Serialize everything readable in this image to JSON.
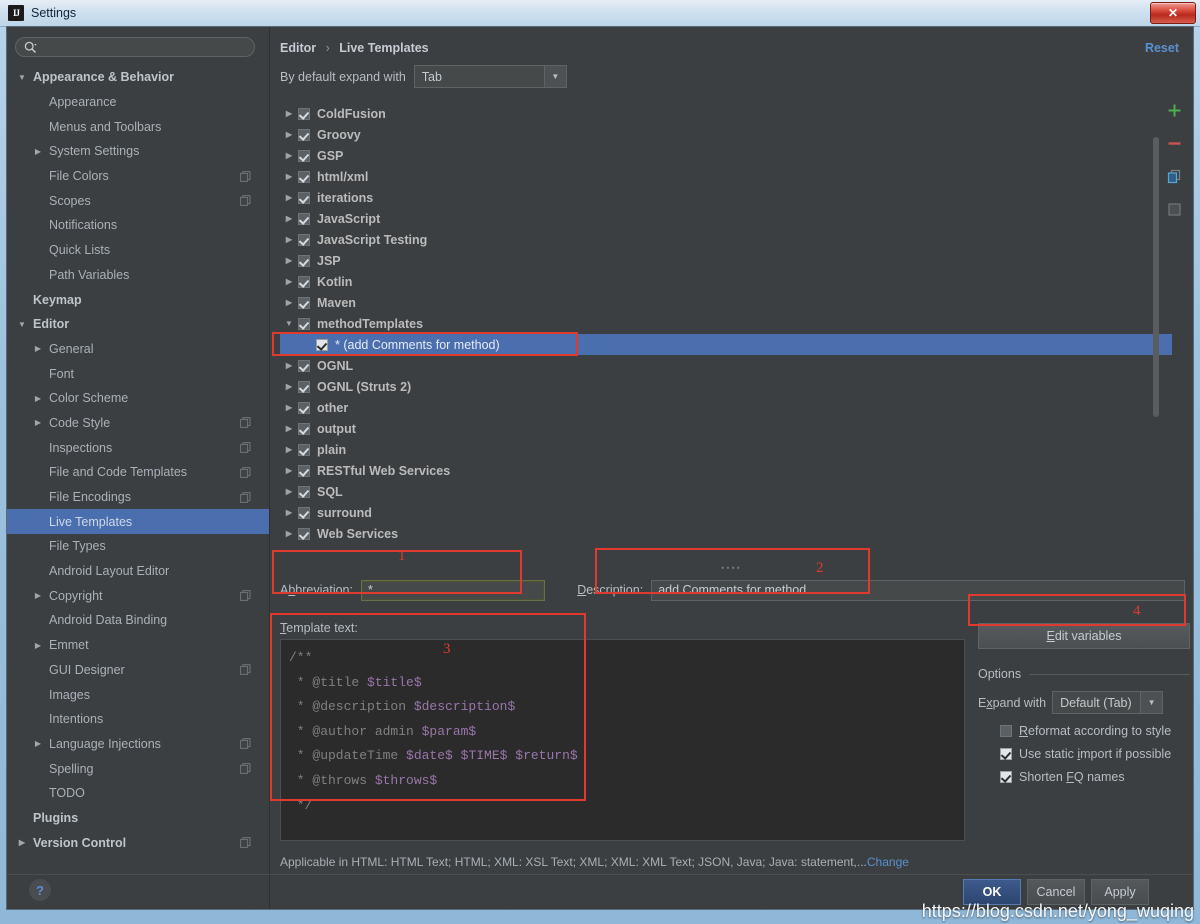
{
  "window": {
    "title": "Settings",
    "app_icon": "IJ",
    "close_label": "✕"
  },
  "search": {
    "placeholder": "",
    "value": "",
    "icon": "search-icon"
  },
  "sidebar": {
    "items": [
      {
        "label": "Appearance & Behavior",
        "arrow": "▼",
        "indent": 0,
        "bold": true,
        "badge": false,
        "selected": false
      },
      {
        "label": "Appearance",
        "arrow": "",
        "indent": 1,
        "bold": false,
        "badge": false,
        "selected": false
      },
      {
        "label": "Menus and Toolbars",
        "arrow": "",
        "indent": 1,
        "bold": false,
        "badge": false,
        "selected": false
      },
      {
        "label": "System Settings",
        "arrow": "▶",
        "indent": 1,
        "bold": false,
        "badge": false,
        "selected": false
      },
      {
        "label": "File Colors",
        "arrow": "",
        "indent": 1,
        "bold": false,
        "badge": true,
        "selected": false
      },
      {
        "label": "Scopes",
        "arrow": "",
        "indent": 1,
        "bold": false,
        "badge": true,
        "selected": false
      },
      {
        "label": "Notifications",
        "arrow": "",
        "indent": 1,
        "bold": false,
        "badge": false,
        "selected": false
      },
      {
        "label": "Quick Lists",
        "arrow": "",
        "indent": 1,
        "bold": false,
        "badge": false,
        "selected": false
      },
      {
        "label": "Path Variables",
        "arrow": "",
        "indent": 1,
        "bold": false,
        "badge": false,
        "selected": false
      },
      {
        "label": "Keymap",
        "arrow": "",
        "indent": 0,
        "bold": true,
        "badge": false,
        "selected": false
      },
      {
        "label": "Editor",
        "arrow": "▼",
        "indent": 0,
        "bold": true,
        "badge": false,
        "selected": false
      },
      {
        "label": "General",
        "arrow": "▶",
        "indent": 1,
        "bold": false,
        "badge": false,
        "selected": false
      },
      {
        "label": "Font",
        "arrow": "",
        "indent": 1,
        "bold": false,
        "badge": false,
        "selected": false
      },
      {
        "label": "Color Scheme",
        "arrow": "▶",
        "indent": 1,
        "bold": false,
        "badge": false,
        "selected": false
      },
      {
        "label": "Code Style",
        "arrow": "▶",
        "indent": 1,
        "bold": false,
        "badge": true,
        "selected": false
      },
      {
        "label": "Inspections",
        "arrow": "",
        "indent": 1,
        "bold": false,
        "badge": true,
        "selected": false
      },
      {
        "label": "File and Code Templates",
        "arrow": "",
        "indent": 1,
        "bold": false,
        "badge": true,
        "selected": false
      },
      {
        "label": "File Encodings",
        "arrow": "",
        "indent": 1,
        "bold": false,
        "badge": true,
        "selected": false
      },
      {
        "label": "Live Templates",
        "arrow": "",
        "indent": 1,
        "bold": false,
        "badge": false,
        "selected": true
      },
      {
        "label": "File Types",
        "arrow": "",
        "indent": 1,
        "bold": false,
        "badge": false,
        "selected": false
      },
      {
        "label": "Android Layout Editor",
        "arrow": "",
        "indent": 1,
        "bold": false,
        "badge": false,
        "selected": false
      },
      {
        "label": "Copyright",
        "arrow": "▶",
        "indent": 1,
        "bold": false,
        "badge": true,
        "selected": false
      },
      {
        "label": "Android Data Binding",
        "arrow": "",
        "indent": 1,
        "bold": false,
        "badge": false,
        "selected": false
      },
      {
        "label": "Emmet",
        "arrow": "▶",
        "indent": 1,
        "bold": false,
        "badge": false,
        "selected": false
      },
      {
        "label": "GUI Designer",
        "arrow": "",
        "indent": 1,
        "bold": false,
        "badge": true,
        "selected": false
      },
      {
        "label": "Images",
        "arrow": "",
        "indent": 1,
        "bold": false,
        "badge": false,
        "selected": false
      },
      {
        "label": "Intentions",
        "arrow": "",
        "indent": 1,
        "bold": false,
        "badge": false,
        "selected": false
      },
      {
        "label": "Language Injections",
        "arrow": "▶",
        "indent": 1,
        "bold": false,
        "badge": true,
        "selected": false
      },
      {
        "label": "Spelling",
        "arrow": "",
        "indent": 1,
        "bold": false,
        "badge": true,
        "selected": false
      },
      {
        "label": "TODO",
        "arrow": "",
        "indent": 1,
        "bold": false,
        "badge": false,
        "selected": false
      },
      {
        "label": "Plugins",
        "arrow": "",
        "indent": 0,
        "bold": true,
        "badge": false,
        "selected": false
      },
      {
        "label": "Version Control",
        "arrow": "▶",
        "indent": 0,
        "bold": true,
        "badge": true,
        "selected": false
      }
    ]
  },
  "main": {
    "breadcrumb_parent": "Editor",
    "breadcrumb_sep": "›",
    "breadcrumb_current": "Live Templates",
    "reset_label": "Reset",
    "expand_with_label": "By default expand with",
    "expand_with_value": "Tab",
    "combo_arrow": "▼"
  },
  "template_tree": {
    "rows": [
      {
        "label": "ColdFusion",
        "arrow": "▶",
        "child": false,
        "checked": true,
        "selected": false
      },
      {
        "label": "Groovy",
        "arrow": "▶",
        "child": false,
        "checked": true,
        "selected": false
      },
      {
        "label": "GSP",
        "arrow": "▶",
        "child": false,
        "checked": true,
        "selected": false
      },
      {
        "label": "html/xml",
        "arrow": "▶",
        "child": false,
        "checked": true,
        "selected": false
      },
      {
        "label": "iterations",
        "arrow": "▶",
        "child": false,
        "checked": true,
        "selected": false
      },
      {
        "label": "JavaScript",
        "arrow": "▶",
        "child": false,
        "checked": true,
        "selected": false
      },
      {
        "label": "JavaScript Testing",
        "arrow": "▶",
        "child": false,
        "checked": true,
        "selected": false
      },
      {
        "label": "JSP",
        "arrow": "▶",
        "child": false,
        "checked": true,
        "selected": false
      },
      {
        "label": "Kotlin",
        "arrow": "▶",
        "child": false,
        "checked": true,
        "selected": false
      },
      {
        "label": "Maven",
        "arrow": "▶",
        "child": false,
        "checked": true,
        "selected": false
      },
      {
        "label": "methodTemplates",
        "arrow": "▼",
        "child": false,
        "checked": true,
        "selected": false
      },
      {
        "label": "* (add Comments for method)",
        "arrow": "",
        "child": true,
        "checked": true,
        "selected": true
      },
      {
        "label": "OGNL",
        "arrow": "▶",
        "child": false,
        "checked": true,
        "selected": false
      },
      {
        "label": "OGNL (Struts 2)",
        "arrow": "▶",
        "child": false,
        "checked": true,
        "selected": false
      },
      {
        "label": "other",
        "arrow": "▶",
        "child": false,
        "checked": true,
        "selected": false
      },
      {
        "label": "output",
        "arrow": "▶",
        "child": false,
        "checked": true,
        "selected": false
      },
      {
        "label": "plain",
        "arrow": "▶",
        "child": false,
        "checked": true,
        "selected": false
      },
      {
        "label": "RESTful Web Services",
        "arrow": "▶",
        "child": false,
        "checked": true,
        "selected": false
      },
      {
        "label": "SQL",
        "arrow": "▶",
        "child": false,
        "checked": true,
        "selected": false
      },
      {
        "label": "surround",
        "arrow": "▶",
        "child": false,
        "checked": true,
        "selected": false
      },
      {
        "label": "Web Services",
        "arrow": "▶",
        "child": false,
        "checked": true,
        "selected": false
      }
    ],
    "toolbar": [
      {
        "name": "add-icon",
        "glyph": "+",
        "color": "#4caf50"
      },
      {
        "name": "remove-icon",
        "glyph": "–",
        "color": "#c75450"
      },
      {
        "name": "copy-icon",
        "glyph": "⧉",
        "color": "#4b93c9"
      },
      {
        "name": "paste-icon",
        "glyph": "▢",
        "color": "#6d7377"
      }
    ]
  },
  "details": {
    "abbreviation_label": "Abbreviation:",
    "abbreviation_value": "*",
    "description_label": "Description:",
    "description_value": "add Comments for method",
    "template_text_label": "Template text:",
    "template_lines": [
      "/**",
      " * @title $title$",
      " * @description $description$",
      " * @author admin $param$",
      " * @updateTime $date$ $TIME$ $return$",
      " * @throws $throws$",
      " */"
    ]
  },
  "options": {
    "edit_variables_label": "Edit variables",
    "title": "Options",
    "expand_with_label": "Expand with",
    "expand_with_value": "Default (Tab)",
    "combo_arrow": "▼",
    "checkboxes": [
      {
        "label": "Reformat according to style",
        "checked": false
      },
      {
        "label": "Use static import if possible",
        "checked": true
      },
      {
        "label": "Shorten FQ names",
        "checked": true
      }
    ]
  },
  "footer": {
    "applicable_text": "Applicable in HTML: HTML Text; HTML; XML: XSL Text; XML; XML: XML Text; JSON, Java; Java: statement,...",
    "change_link": "Change",
    "help_glyph": "?",
    "buttons": [
      {
        "label": "OK",
        "primary": true
      },
      {
        "label": "Cancel",
        "primary": false
      },
      {
        "label": "Apply",
        "primary": false
      }
    ]
  },
  "annotations": [
    {
      "number": "1"
    },
    {
      "number": "2"
    },
    {
      "number": "3"
    },
    {
      "number": "4"
    }
  ],
  "watermark": "https://blog.csdn.net/yong_wuqing",
  "colors": {
    "accent_selection": "#4b6eaf",
    "link": "#5a90d0",
    "annotation": "#e03a2f",
    "panel_bg": "#3c3f41",
    "editor_bg": "#2b2b2b"
  }
}
